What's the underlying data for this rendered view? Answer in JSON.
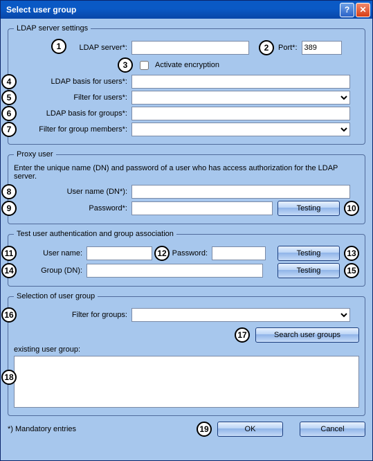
{
  "window": {
    "title": "Select user group"
  },
  "ldap": {
    "legend": "LDAP server settings",
    "server_label": "LDAP server*:",
    "server_value": "",
    "port_label": "Port*:",
    "port_value": "389",
    "encrypt_label": "Activate encryption",
    "basis_users_label": "LDAP basis for users*:",
    "basis_users_value": "",
    "filter_users_label": "Filter for users*:",
    "filter_users_value": "",
    "basis_groups_label": "LDAP basis for groups*:",
    "basis_groups_value": "",
    "filter_members_label": "Filter for group members*:",
    "filter_members_value": ""
  },
  "proxy": {
    "legend": "Proxy user",
    "intro": "Enter the unique name (DN) and password of a user who has access authorization for the LDAP server.",
    "username_label": "User name (DN*):",
    "username_value": "",
    "password_label": "Password*:",
    "password_value": "",
    "testing_label": "Testing"
  },
  "test": {
    "legend": "Test user authentication and group association",
    "username_label": "User name:",
    "username_value": "",
    "password_label": "Password:",
    "password_value": "",
    "group_label": "Group (DN):",
    "group_value": "",
    "testing_label": "Testing"
  },
  "selection": {
    "legend": "Selection of user group",
    "filter_label": "Filter for groups:",
    "filter_value": "",
    "search_label": "Search user groups",
    "existing_label": "existing user group:"
  },
  "footer": {
    "mandatory": "*) Mandatory entries",
    "ok": "OK",
    "cancel": "Cancel"
  },
  "callouts": {
    "c1": "1",
    "c2": "2",
    "c3": "3",
    "c4": "4",
    "c5": "5",
    "c6": "6",
    "c7": "7",
    "c8": "8",
    "c9": "9",
    "c10": "10",
    "c11": "11",
    "c12": "12",
    "c13": "13",
    "c14": "14",
    "c15": "15",
    "c16": "16",
    "c17": "17",
    "c18": "18",
    "c19": "19"
  }
}
